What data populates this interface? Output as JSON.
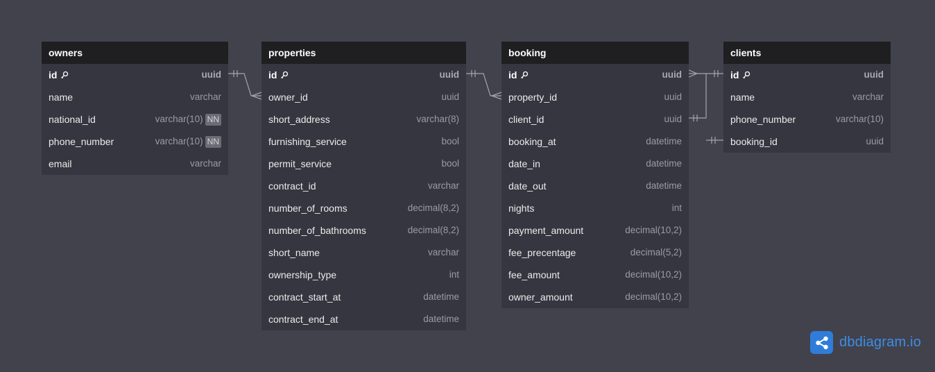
{
  "tables": {
    "owners": {
      "title": "owners",
      "fields": [
        {
          "name": "id",
          "type": "uuid",
          "pk": true
        },
        {
          "name": "name",
          "type": "varchar"
        },
        {
          "name": "national_id",
          "type": "varchar(10)",
          "badge": "NN"
        },
        {
          "name": "phone_number",
          "type": "varchar(10)",
          "badge": "NN"
        },
        {
          "name": "email",
          "type": "varchar"
        }
      ]
    },
    "properties": {
      "title": "properties",
      "fields": [
        {
          "name": "id",
          "type": "uuid",
          "pk": true
        },
        {
          "name": "owner_id",
          "type": "uuid"
        },
        {
          "name": "short_address",
          "type": "varchar(8)"
        },
        {
          "name": "furnishing_service",
          "type": "bool"
        },
        {
          "name": "permit_service",
          "type": "bool"
        },
        {
          "name": "contract_id",
          "type": "varchar"
        },
        {
          "name": "number_of_rooms",
          "type": "decimal(8,2)"
        },
        {
          "name": "number_of_bathrooms",
          "type": "decimal(8,2)"
        },
        {
          "name": "short_name",
          "type": "varchar"
        },
        {
          "name": "ownership_type",
          "type": "int"
        },
        {
          "name": "contract_start_at",
          "type": "datetime"
        },
        {
          "name": "contract_end_at",
          "type": "datetime"
        }
      ]
    },
    "booking": {
      "title": "booking",
      "fields": [
        {
          "name": "id",
          "type": "uuid",
          "pk": true
        },
        {
          "name": "property_id",
          "type": "uuid"
        },
        {
          "name": "client_id",
          "type": "uuid"
        },
        {
          "name": "booking_at",
          "type": "datetime"
        },
        {
          "name": "date_in",
          "type": "datetime"
        },
        {
          "name": "date_out",
          "type": "datetime"
        },
        {
          "name": "nights",
          "type": "int"
        },
        {
          "name": "payment_amount",
          "type": "decimal(10,2)"
        },
        {
          "name": "fee_precentage",
          "type": "decimal(5,2)"
        },
        {
          "name": "fee_amount",
          "type": "decimal(10,2)"
        },
        {
          "name": "owner_amount",
          "type": "decimal(10,2)"
        }
      ]
    },
    "clients": {
      "title": "clients",
      "fields": [
        {
          "name": "id",
          "type": "uuid",
          "pk": true
        },
        {
          "name": "name",
          "type": "varchar"
        },
        {
          "name": "phone_number",
          "type": "varchar(10)"
        },
        {
          "name": "booking_id",
          "type": "uuid"
        }
      ]
    }
  },
  "relationships": [
    {
      "from": "owners.id",
      "to": "properties.owner_id",
      "cardinality": "one-to-many"
    },
    {
      "from": "properties.id",
      "to": "booking.property_id",
      "cardinality": "one-to-many"
    },
    {
      "from": "clients.id",
      "to": "booking.id",
      "cardinality": "one-to-many"
    },
    {
      "from": "booking.client_id",
      "to": "clients.id",
      "cardinality": "one-to-one"
    },
    {
      "from": "clients.booking_id",
      "to": "booking.id",
      "cardinality": "one-to-one"
    }
  ],
  "brand": {
    "text": "dbdiagram.io",
    "icon": "share-icon",
    "color": "#2f7dd9"
  },
  "colors": {
    "background": "#41424c",
    "table_body": "#35363f",
    "table_header": "#1f1f22",
    "connector": "#a5a5ad"
  }
}
